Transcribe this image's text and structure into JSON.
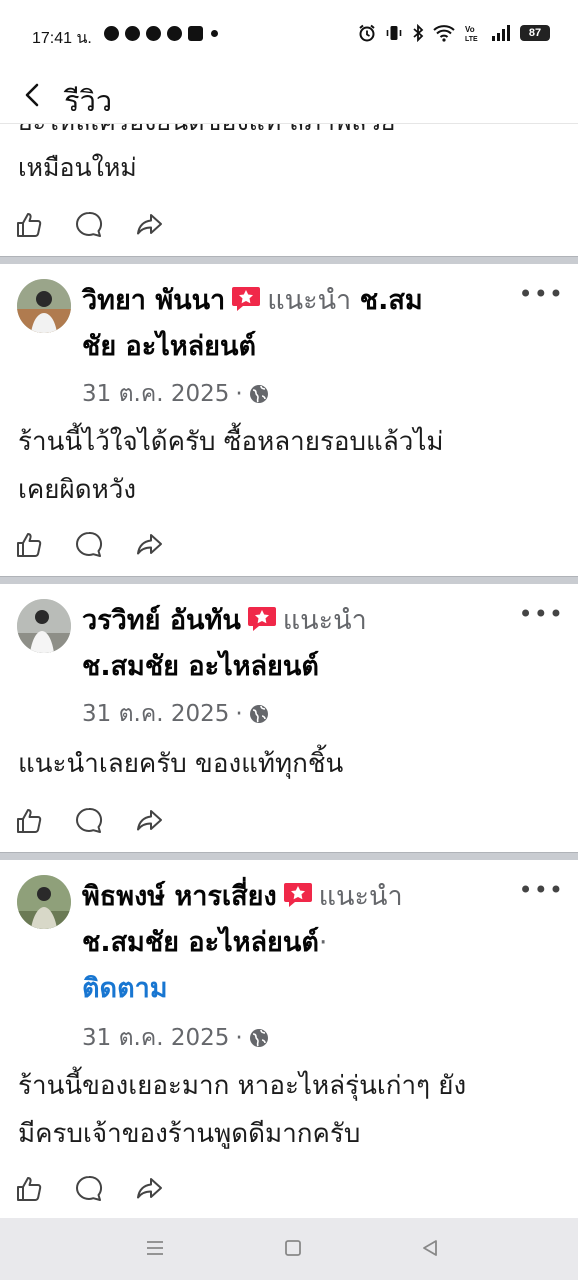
{
  "status_bar": {
    "time": "17:41 น.",
    "battery": "87",
    "icons": [
      "chat-bubble-icon",
      "facebook-icon",
      "facebook-icon",
      "messenger-icon",
      "gmail-icon",
      "dot-icon",
      "alarm-icon",
      "vibrate-icon",
      "bluetooth-icon",
      "wifi-icon",
      "volte-icon",
      "signal-icon",
      "battery-icon"
    ]
  },
  "header": {
    "title": "รีวิว",
    "back_icon": "chevron-left-icon"
  },
  "partial_post": {
    "line1": "ยะไหล่เครื่องยนต์ของแท้ สภาพสวย",
    "line2": "เหมือนใหม่"
  },
  "reviews": [
    {
      "name": "วิทยา พันนา",
      "recommend": "แนะนำ",
      "page_name_a": "ช.สม",
      "page_name_b": "ชัย อะไหล่ยนต์",
      "date": "31 ต.ค. 2025",
      "text_line1": "ร้านนี้ไว้ใจได้ครับ ซื้อหลายรอบแล้วไม่",
      "text_line2": "เคยผิดหวัง"
    },
    {
      "name": "วรวิทย์ อันทัน",
      "recommend": "แนะนำ",
      "page_name": "ช.สมชัย อะไหล่ยนต์",
      "date": "31 ต.ค. 2025",
      "text_line1": "แนะนำเลยครับ ของแท้ทุกชิ้น"
    },
    {
      "name": "พิธพงษ์ หารเสี่ยง",
      "recommend": "แนะนำ",
      "page_name": "ช.สมชัย อะไหล่ยนต์",
      "follow": "ติดตาม",
      "date": "31 ต.ค. 2025",
      "text_line1": "ร้านนี้ของเยอะมาก หาอะไหล่รุ่นเก่าๆ ยัง",
      "text_line2": "มีครบเจ้าของร้านพูดดีมากครับ"
    }
  ],
  "more_glyph": "•••",
  "separator_dot": "·",
  "colors": {
    "link": "#1876d1",
    "muted": "#65676b",
    "recommend_badge": "#f02849"
  }
}
